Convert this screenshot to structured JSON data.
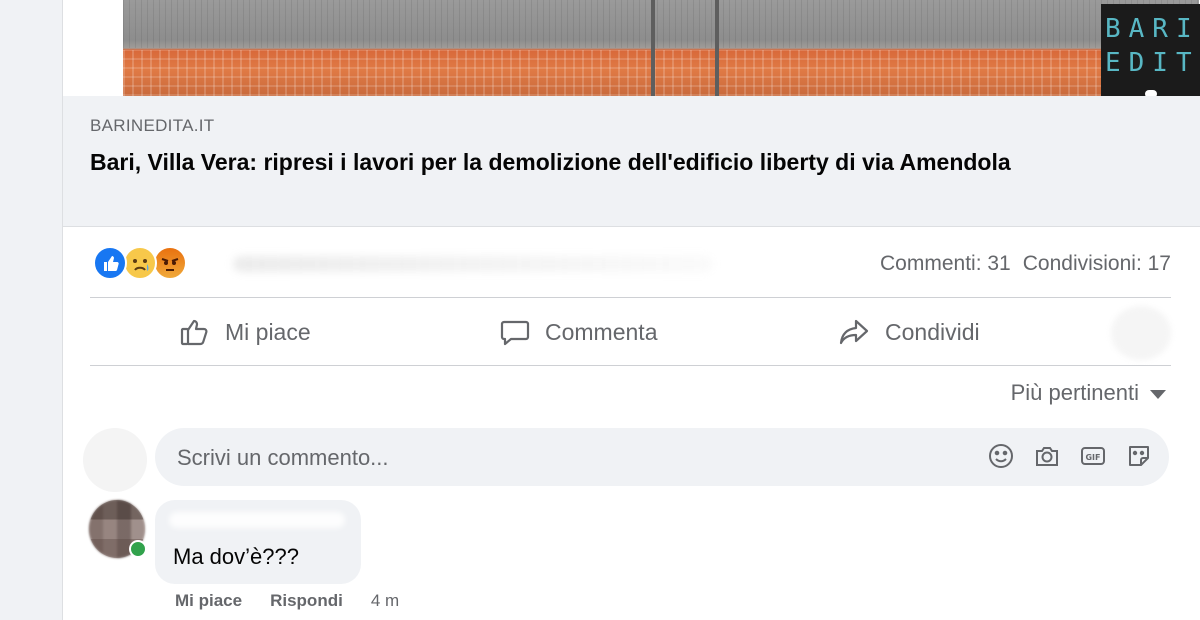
{
  "link_preview": {
    "domain": "BARINEDITA.IT",
    "headline": "Bari, Villa Vera: ripresi i lavori per la demolizione dell'edificio liberty di via Amendola",
    "watermark_line1": "BARIN",
    "watermark_line2": "EDITA",
    "image_colors": {
      "fence": "#e07a45",
      "sky": "#9a9a9a"
    }
  },
  "reactions": {
    "icons": [
      "like-icon",
      "sad-icon",
      "angry-icon"
    ],
    "comments_label": "Commenti: 31",
    "shares_label": "Condivisioni: 17"
  },
  "actions": {
    "like": "Mi piace",
    "comment": "Commenta",
    "share": "Condividi"
  },
  "sort": {
    "label": "Più pertinenti"
  },
  "composer": {
    "placeholder": "Scrivi un commento...",
    "icons": [
      "emoji-icon",
      "camera-icon",
      "gif-icon",
      "sticker-icon"
    ]
  },
  "comments": [
    {
      "text": "Ma dov’è???",
      "like_label": "Mi piace",
      "reply_label": "Rispondi",
      "time": "4 m"
    }
  ],
  "colors": {
    "accent": "#1877f2",
    "secondary_text": "#65676b",
    "online": "#31a24c"
  }
}
